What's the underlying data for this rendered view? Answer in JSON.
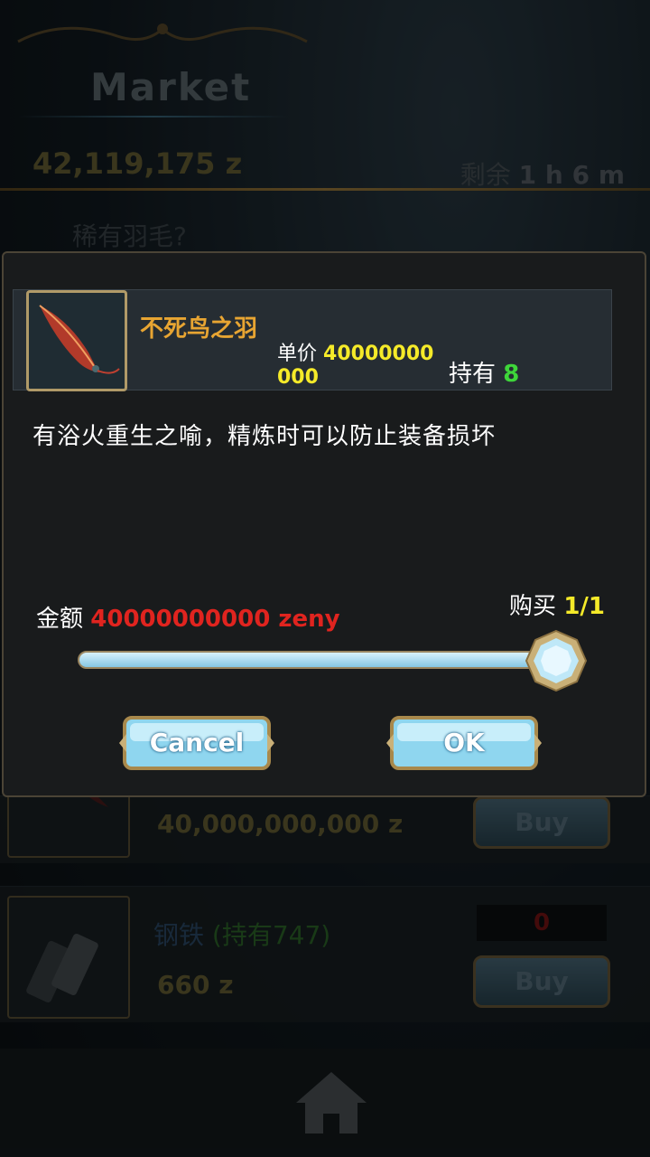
{
  "header": {
    "title": "Market",
    "money": "42,119,175 z",
    "remaining_label": "剩余",
    "remaining_value": "1 h 6 m",
    "subtitle": "稀有羽毛?"
  },
  "dialog": {
    "item_name": "不死鸟之羽",
    "unit_price_label": "单价",
    "unit_price_value": "40000000000",
    "hold_label": "持有",
    "hold_value": "8",
    "description": "有浴火重生之喻，精炼时可以防止装备损坏",
    "amount_label": "金额",
    "amount_value": "40000000000 zeny",
    "purchase_label": "购买",
    "purchase_value": "1/1",
    "slider_fraction": 1.0,
    "cancel_label": "Cancel",
    "ok_label": "OK"
  },
  "rows": [
    {
      "price": "40,000,000,000 z",
      "buy_label": "Buy"
    },
    {
      "name": "钢铁",
      "hold_text": "(持有747)",
      "price": "660 z",
      "qty": "0",
      "buy_label": "Buy"
    }
  ],
  "colors": {
    "gold_text": "#e8a532",
    "price_yellow": "#f5ea29",
    "hold_green": "#3ed63a",
    "amount_red": "#e0241f",
    "button_blue": "#8fd6ef"
  },
  "icons": [
    "feather-icon",
    "steel-icon",
    "home-icon",
    "slider-knob-icon"
  ]
}
